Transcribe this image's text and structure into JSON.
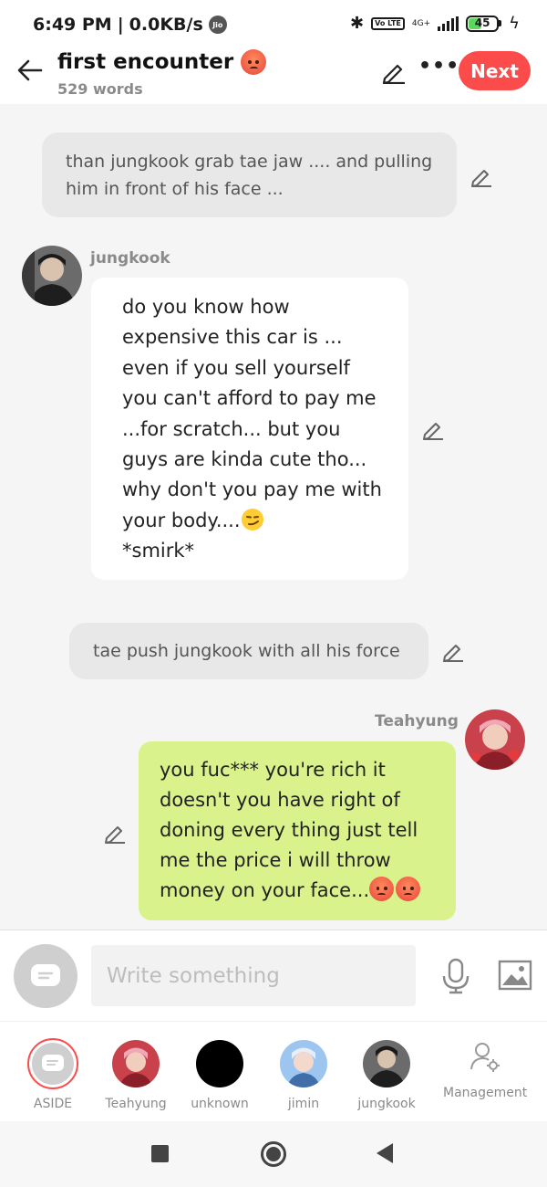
{
  "status_bar": {
    "time": "6:49 PM",
    "separator": "|",
    "speed": "0.0KB/s",
    "carrier_badge": "Jio",
    "network": "4G+",
    "volte": "Vo LTE",
    "battery_percent": "45",
    "battery_level": 0.45
  },
  "header": {
    "title": "first encounter",
    "title_emoji": "angry-face-emoji",
    "word_count": "529 words",
    "more_label": "•••",
    "next_label": "Next"
  },
  "messages": [
    {
      "type": "aside",
      "text": "than jungkook grab tae jaw .... and pulling him in front of his face ..."
    },
    {
      "type": "character",
      "side": "left",
      "speaker": "jungkook",
      "avatar": "jungkook-avatar",
      "text": "do you know how expensive this car is ... even if you sell yourself you can't afford to pay me ...for scratch... but you guys are kinda cute tho... why don't you pay me with your body....",
      "emoji": "smirk-emoji",
      "tail": "*smirk*"
    },
    {
      "type": "aside",
      "text": "tae push jungkook with all his force"
    },
    {
      "type": "character",
      "side": "right",
      "speaker": "Teahyung",
      "avatar": "teahyung-avatar",
      "text": "you fuc*** you're rich it doesn't you have right of doning every thing just tell me the price i will throw money on your face...",
      "emoji": "angry-face-emoji",
      "emoji_count": 2
    }
  ],
  "composer": {
    "placeholder": "Write something"
  },
  "characters": [
    {
      "label": "ASIDE",
      "icon": "aside-icon",
      "selected": true
    },
    {
      "label": "Teahyung",
      "icon": "teahyung-avatar"
    },
    {
      "label": "unknown",
      "icon": "black-circle-avatar"
    },
    {
      "label": "jimin",
      "icon": "jimin-avatar"
    },
    {
      "label": "jungkook",
      "icon": "jungkook-avatar"
    },
    {
      "label": "Management",
      "icon": "person-gear-icon"
    }
  ],
  "colors": {
    "accent": "#fb4b4b",
    "bubble_green": "#d9f28c",
    "aside_gray": "#e8e8e8",
    "background": "#f5f5f5"
  }
}
